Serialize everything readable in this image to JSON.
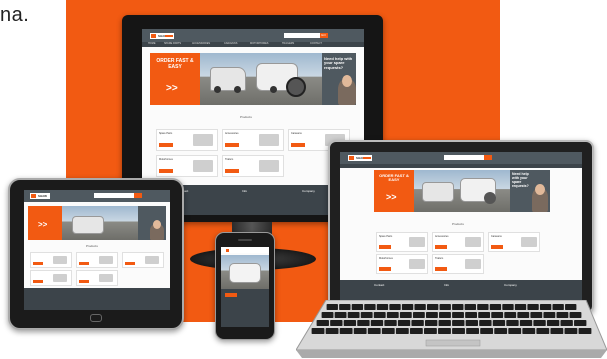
{
  "caption": "na.",
  "colors": {
    "brand": "#f25a12",
    "header": "#4f5960",
    "nav": "#3c444a"
  },
  "site": {
    "logo_text": "SHAW",
    "search_button": "GO",
    "promo_title": "ORDER FAST & EASY",
    "promo_arrow": ">>",
    "help_title": "Need help with your spare requests?",
    "section_title": "Products",
    "products": [
      {
        "title": "Spare Parts"
      },
      {
        "title": "Accessories"
      },
      {
        "title": "Caravans"
      },
      {
        "title": "Motorhomes"
      },
      {
        "title": "Trailers"
      }
    ],
    "footer_cols": [
      {
        "heading": "Contact"
      },
      {
        "heading": "Info"
      },
      {
        "heading": "Company"
      }
    ]
  },
  "devices": {
    "monitor": "desktop-monitor",
    "laptop": "laptop",
    "tablet": "tablet",
    "phone": "smartphone"
  }
}
